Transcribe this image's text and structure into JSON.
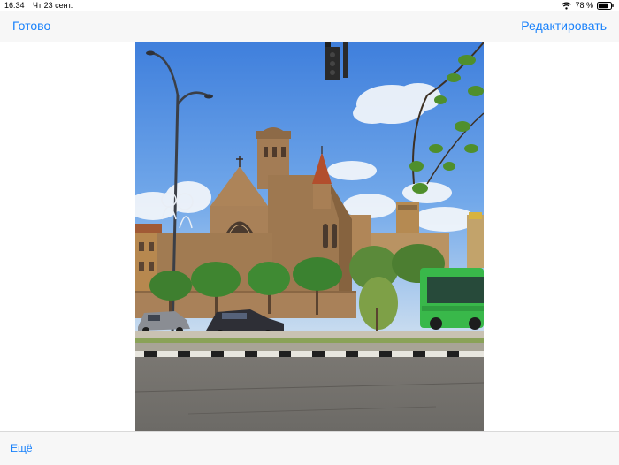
{
  "status_bar": {
    "time": "16:34",
    "date": "Чт 23 сент.",
    "battery_percent": "78 %",
    "battery_level": 0.78,
    "icons": [
      "wifi-icon",
      "battery-icon"
    ]
  },
  "nav": {
    "done_label": "Готово",
    "edit_label": "Редактировать"
  },
  "photo": {
    "subject": "church-street-photo"
  },
  "bottom": {
    "more_label": "Ещё"
  },
  "colors": {
    "accent": "#1a82fb",
    "bar_background": "#f7f7f7",
    "sky": "#4f8fe6",
    "stone": "#a88560",
    "bus_green": "#3cc04a"
  }
}
